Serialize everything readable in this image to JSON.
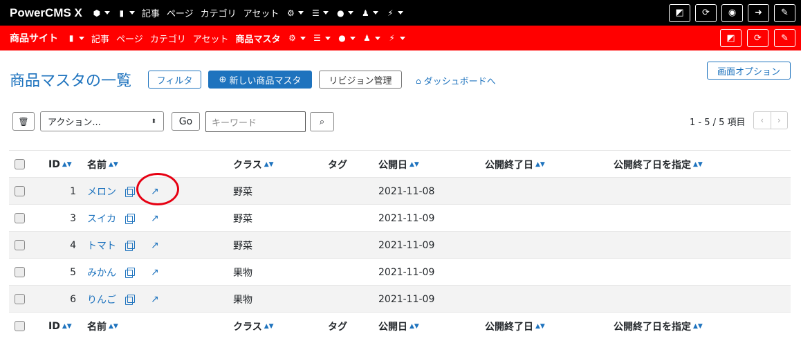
{
  "topbar": {
    "brand": "PowerCMS X",
    "items": [
      "記事",
      "ページ",
      "カテゴリ",
      "アセット"
    ]
  },
  "sitebar": {
    "site": "商品サイト",
    "items": [
      "記事",
      "ページ",
      "カテゴリ",
      "アセット"
    ],
    "active": "商品マスタ"
  },
  "page": {
    "title": "商品マスタの一覧",
    "filter_button": "フィルタ",
    "new_button": "新しい商品マスタ",
    "revision_button": "リビジョン管理",
    "dashboard_link": "ダッシュボードへ",
    "screen_options": "画面オプション"
  },
  "toolbar": {
    "action_select": "アクション...",
    "go_button": "Go",
    "keyword_placeholder": "キーワード",
    "count": "1 - 5 / 5 項目"
  },
  "table": {
    "headers": {
      "id": "ID",
      "name": "名前",
      "class": "クラス",
      "tag": "タグ",
      "published": "公開日",
      "end": "公開終了日",
      "specify_end": "公開終了日を指定"
    },
    "rows": [
      {
        "id": "1",
        "name": "メロン",
        "class": "野菜",
        "published": "2021-11-08"
      },
      {
        "id": "3",
        "name": "スイカ",
        "class": "野菜",
        "published": "2021-11-09"
      },
      {
        "id": "4",
        "name": "トマト",
        "class": "野菜",
        "published": "2021-11-09"
      },
      {
        "id": "5",
        "name": "みかん",
        "class": "果物",
        "published": "2021-11-09"
      },
      {
        "id": "6",
        "name": "りんご",
        "class": "果物",
        "published": "2021-11-09"
      }
    ]
  }
}
